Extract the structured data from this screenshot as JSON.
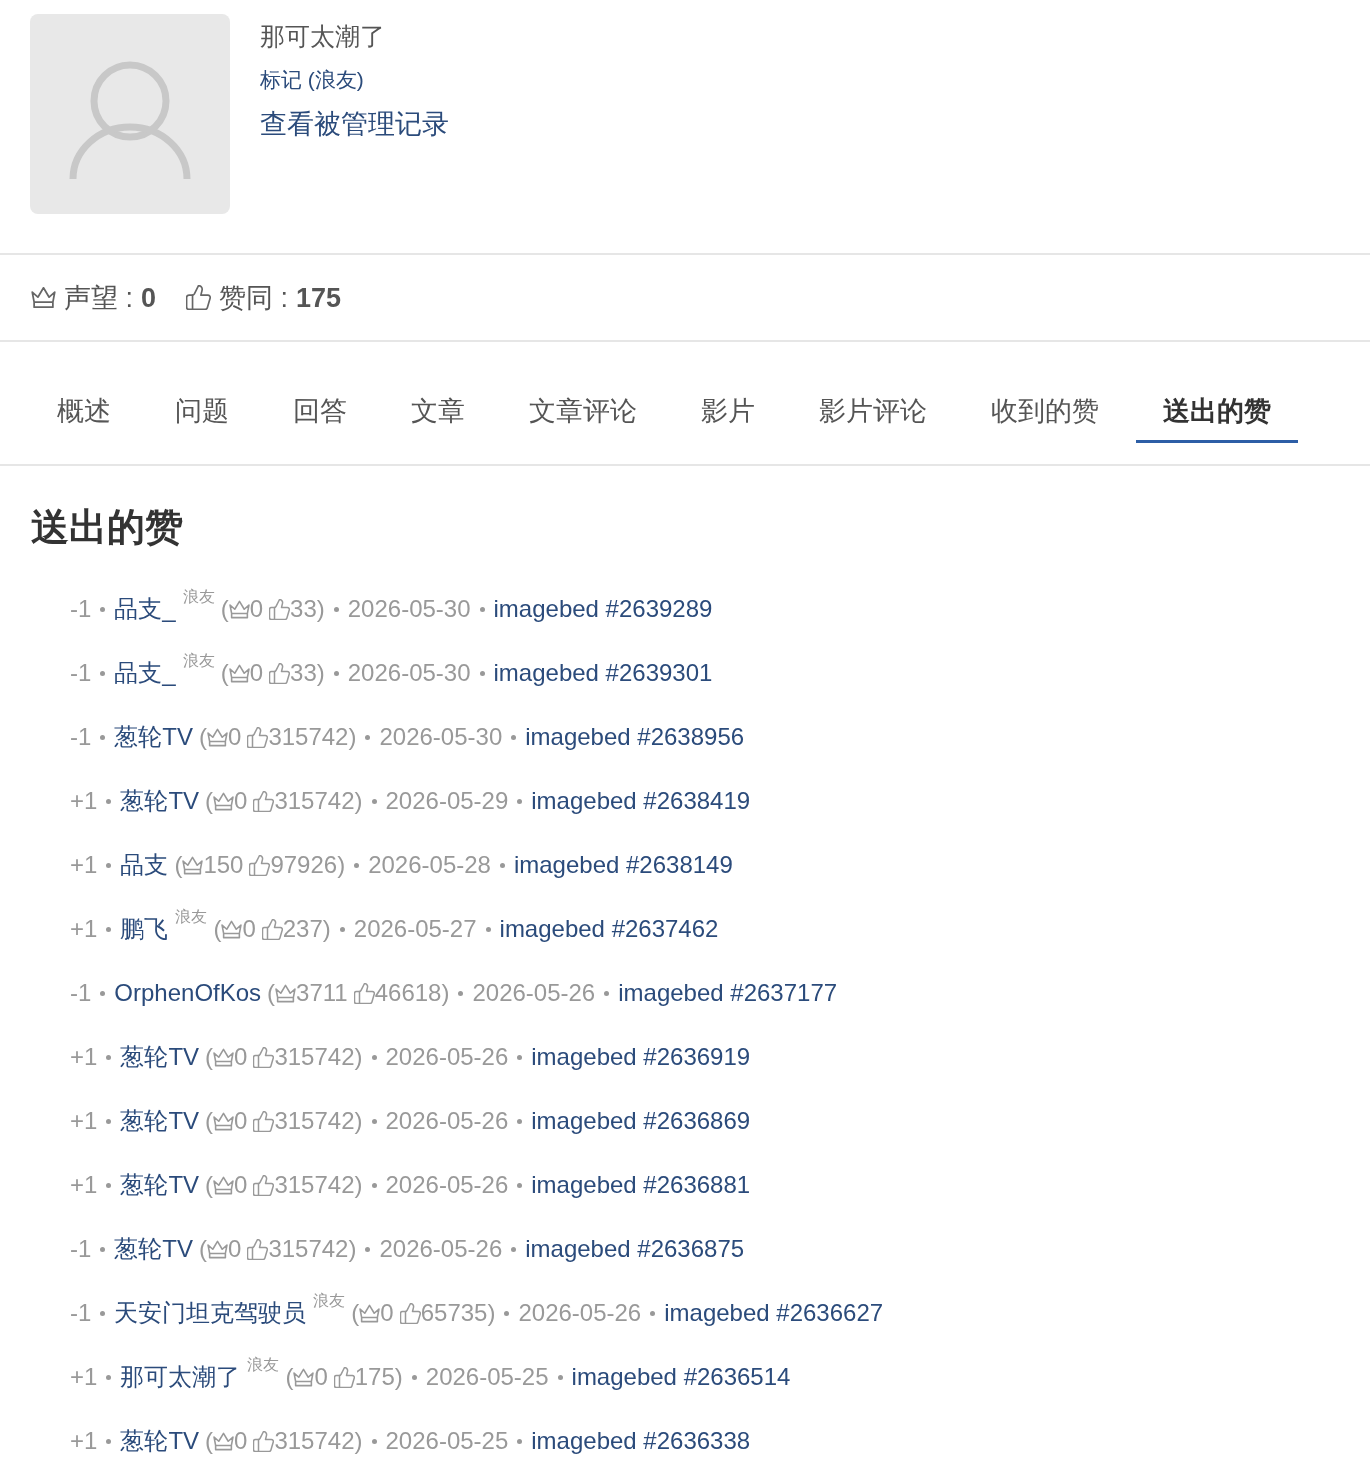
{
  "profile": {
    "name": "那可太潮了",
    "mark_link": "标记 (浪友)",
    "manage_link": "查看被管理记录"
  },
  "stats": [
    {
      "kind": "reputation",
      "label": "声望 :",
      "value": "0"
    },
    {
      "kind": "likes",
      "label": "赞同 :",
      "value": "175"
    }
  ],
  "tabs": [
    {
      "label": "概述",
      "selected": false
    },
    {
      "label": "问题",
      "selected": false
    },
    {
      "label": "回答",
      "selected": false
    },
    {
      "label": "文章",
      "selected": false
    },
    {
      "label": "文章评论",
      "selected": false
    },
    {
      "label": "影片",
      "selected": false
    },
    {
      "label": "影片评论",
      "selected": false
    },
    {
      "label": "收到的赞",
      "selected": false
    },
    {
      "label": "送出的赞",
      "selected": true
    }
  ],
  "section_title": "送出的赞",
  "votes": [
    {
      "vote": "-1",
      "user": "品支_",
      "badge": "浪友",
      "open": "(",
      "reputation": "0",
      "likes": "33",
      "close": ")",
      "date": "2026-05-30",
      "target": "imagebed #2639289"
    },
    {
      "vote": "-1",
      "user": "品支_",
      "badge": "浪友",
      "open": "(",
      "reputation": "0",
      "likes": "33",
      "close": ")",
      "date": "2026-05-30",
      "target": "imagebed #2639301"
    },
    {
      "vote": "-1",
      "user": "葱轮TV",
      "open": "(",
      "reputation": "0",
      "likes": "315742",
      "close": ")",
      "date": "2026-05-30",
      "target": "imagebed #2638956"
    },
    {
      "vote": "+1",
      "user": "葱轮TV",
      "open": "(",
      "reputation": "0",
      "likes": "315742",
      "close": ")",
      "date": "2026-05-29",
      "target": "imagebed #2638419"
    },
    {
      "vote": "+1",
      "user": "品支",
      "open": "(",
      "reputation": "150",
      "likes": "97926",
      "close": ")",
      "date": "2026-05-28",
      "target": "imagebed #2638149"
    },
    {
      "vote": "+1",
      "user": "鹏飞",
      "badge": "浪友",
      "open": "(",
      "reputation": "0",
      "likes": "237",
      "close": ")",
      "date": "2026-05-27",
      "target": "imagebed #2637462"
    },
    {
      "vote": "-1",
      "user": "OrphenOfKos",
      "open": "(",
      "reputation": "3711",
      "likes": "46618",
      "close": ")",
      "date": "2026-05-26",
      "target": "imagebed #2637177"
    },
    {
      "vote": "+1",
      "user": "葱轮TV",
      "open": "(",
      "reputation": "0",
      "likes": "315742",
      "close": ")",
      "date": "2026-05-26",
      "target": "imagebed #2636919"
    },
    {
      "vote": "+1",
      "user": "葱轮TV",
      "open": "(",
      "reputation": "0",
      "likes": "315742",
      "close": ")",
      "date": "2026-05-26",
      "target": "imagebed #2636869"
    },
    {
      "vote": "+1",
      "user": "葱轮TV",
      "open": "(",
      "reputation": "0",
      "likes": "315742",
      "close": ")",
      "date": "2026-05-26",
      "target": "imagebed #2636881"
    },
    {
      "vote": "-1",
      "user": "葱轮TV",
      "open": "(",
      "reputation": "0",
      "likes": "315742",
      "close": ")",
      "date": "2026-05-26",
      "target": "imagebed #2636875"
    },
    {
      "vote": "-1",
      "user": "天安门坦克驾驶员",
      "badge": "浪友",
      "open": "(",
      "reputation": "0",
      "likes": "65735",
      "close": ")",
      "date": "2026-05-26",
      "target": "imagebed #2636627"
    },
    {
      "vote": "+1",
      "user": "那可太潮了",
      "badge": "浪友",
      "open": "(",
      "reputation": "0",
      "likes": "175",
      "close": ")",
      "date": "2026-05-25",
      "target": "imagebed #2636514"
    },
    {
      "vote": "+1",
      "user": "葱轮TV",
      "open": "(",
      "reputation": "0",
      "likes": "315742",
      "close": ")",
      "date": "2026-05-25",
      "target": "imagebed #2636338"
    }
  ]
}
